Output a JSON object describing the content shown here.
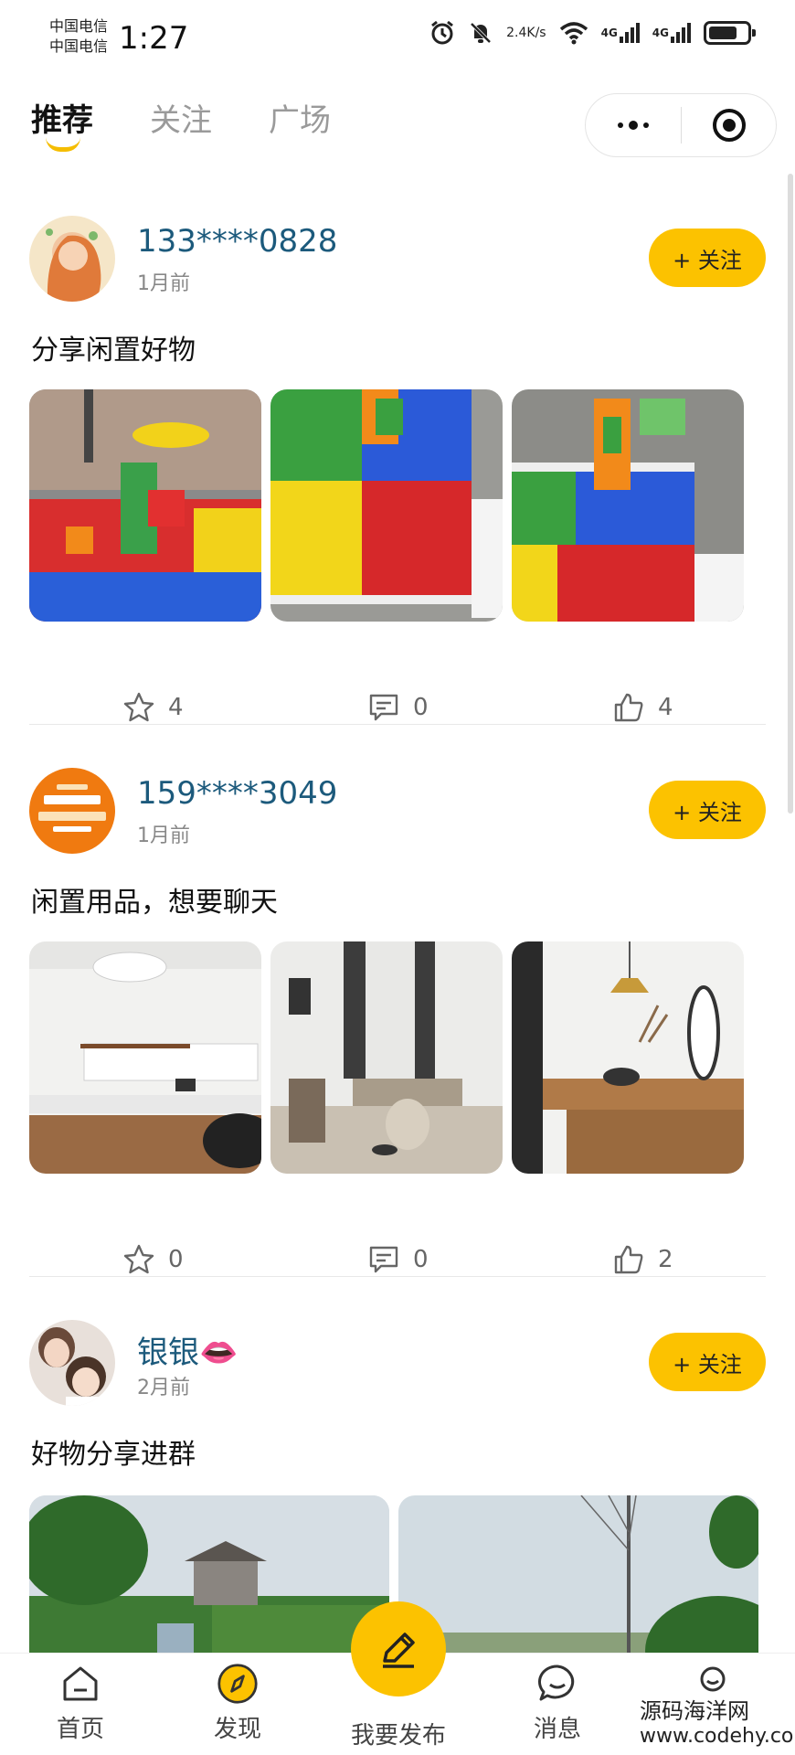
{
  "status_bar": {
    "carrier_1": "中国电信",
    "carrier_2": "中国电信",
    "time": "1:27",
    "net_speed_value": "2.4",
    "net_speed_unit": "K/s",
    "net_type_1": "4G",
    "net_type_2": "4G",
    "battery_level": 0.75
  },
  "tabs": [
    {
      "label": "推荐",
      "active": true
    },
    {
      "label": "关注",
      "active": false
    },
    {
      "label": "广场",
      "active": false
    }
  ],
  "posts": [
    {
      "username": "133****0828",
      "time": "1月前",
      "follow_label": "+ 关注",
      "content": "分享闲置好物",
      "favorites": "4",
      "comments": "0",
      "likes": "4"
    },
    {
      "username": "159****3049",
      "time": "1月前",
      "follow_label": "+ 关注",
      "content": "闲置用品，想要聊天",
      "favorites": "0",
      "comments": "0",
      "likes": "2"
    },
    {
      "username": "银银👄",
      "time": "2月前",
      "follow_label": "+ 关注",
      "content": "好物分享进群"
    }
  ],
  "nav": {
    "home": "首页",
    "discover": "发现",
    "publish": "我要发布",
    "messages": "消息"
  },
  "watermark": {
    "line1": "源码海洋网",
    "line2": "www.codehy.com"
  },
  "colors": {
    "accent": "#fcc200",
    "username": "#1c5a7c"
  }
}
